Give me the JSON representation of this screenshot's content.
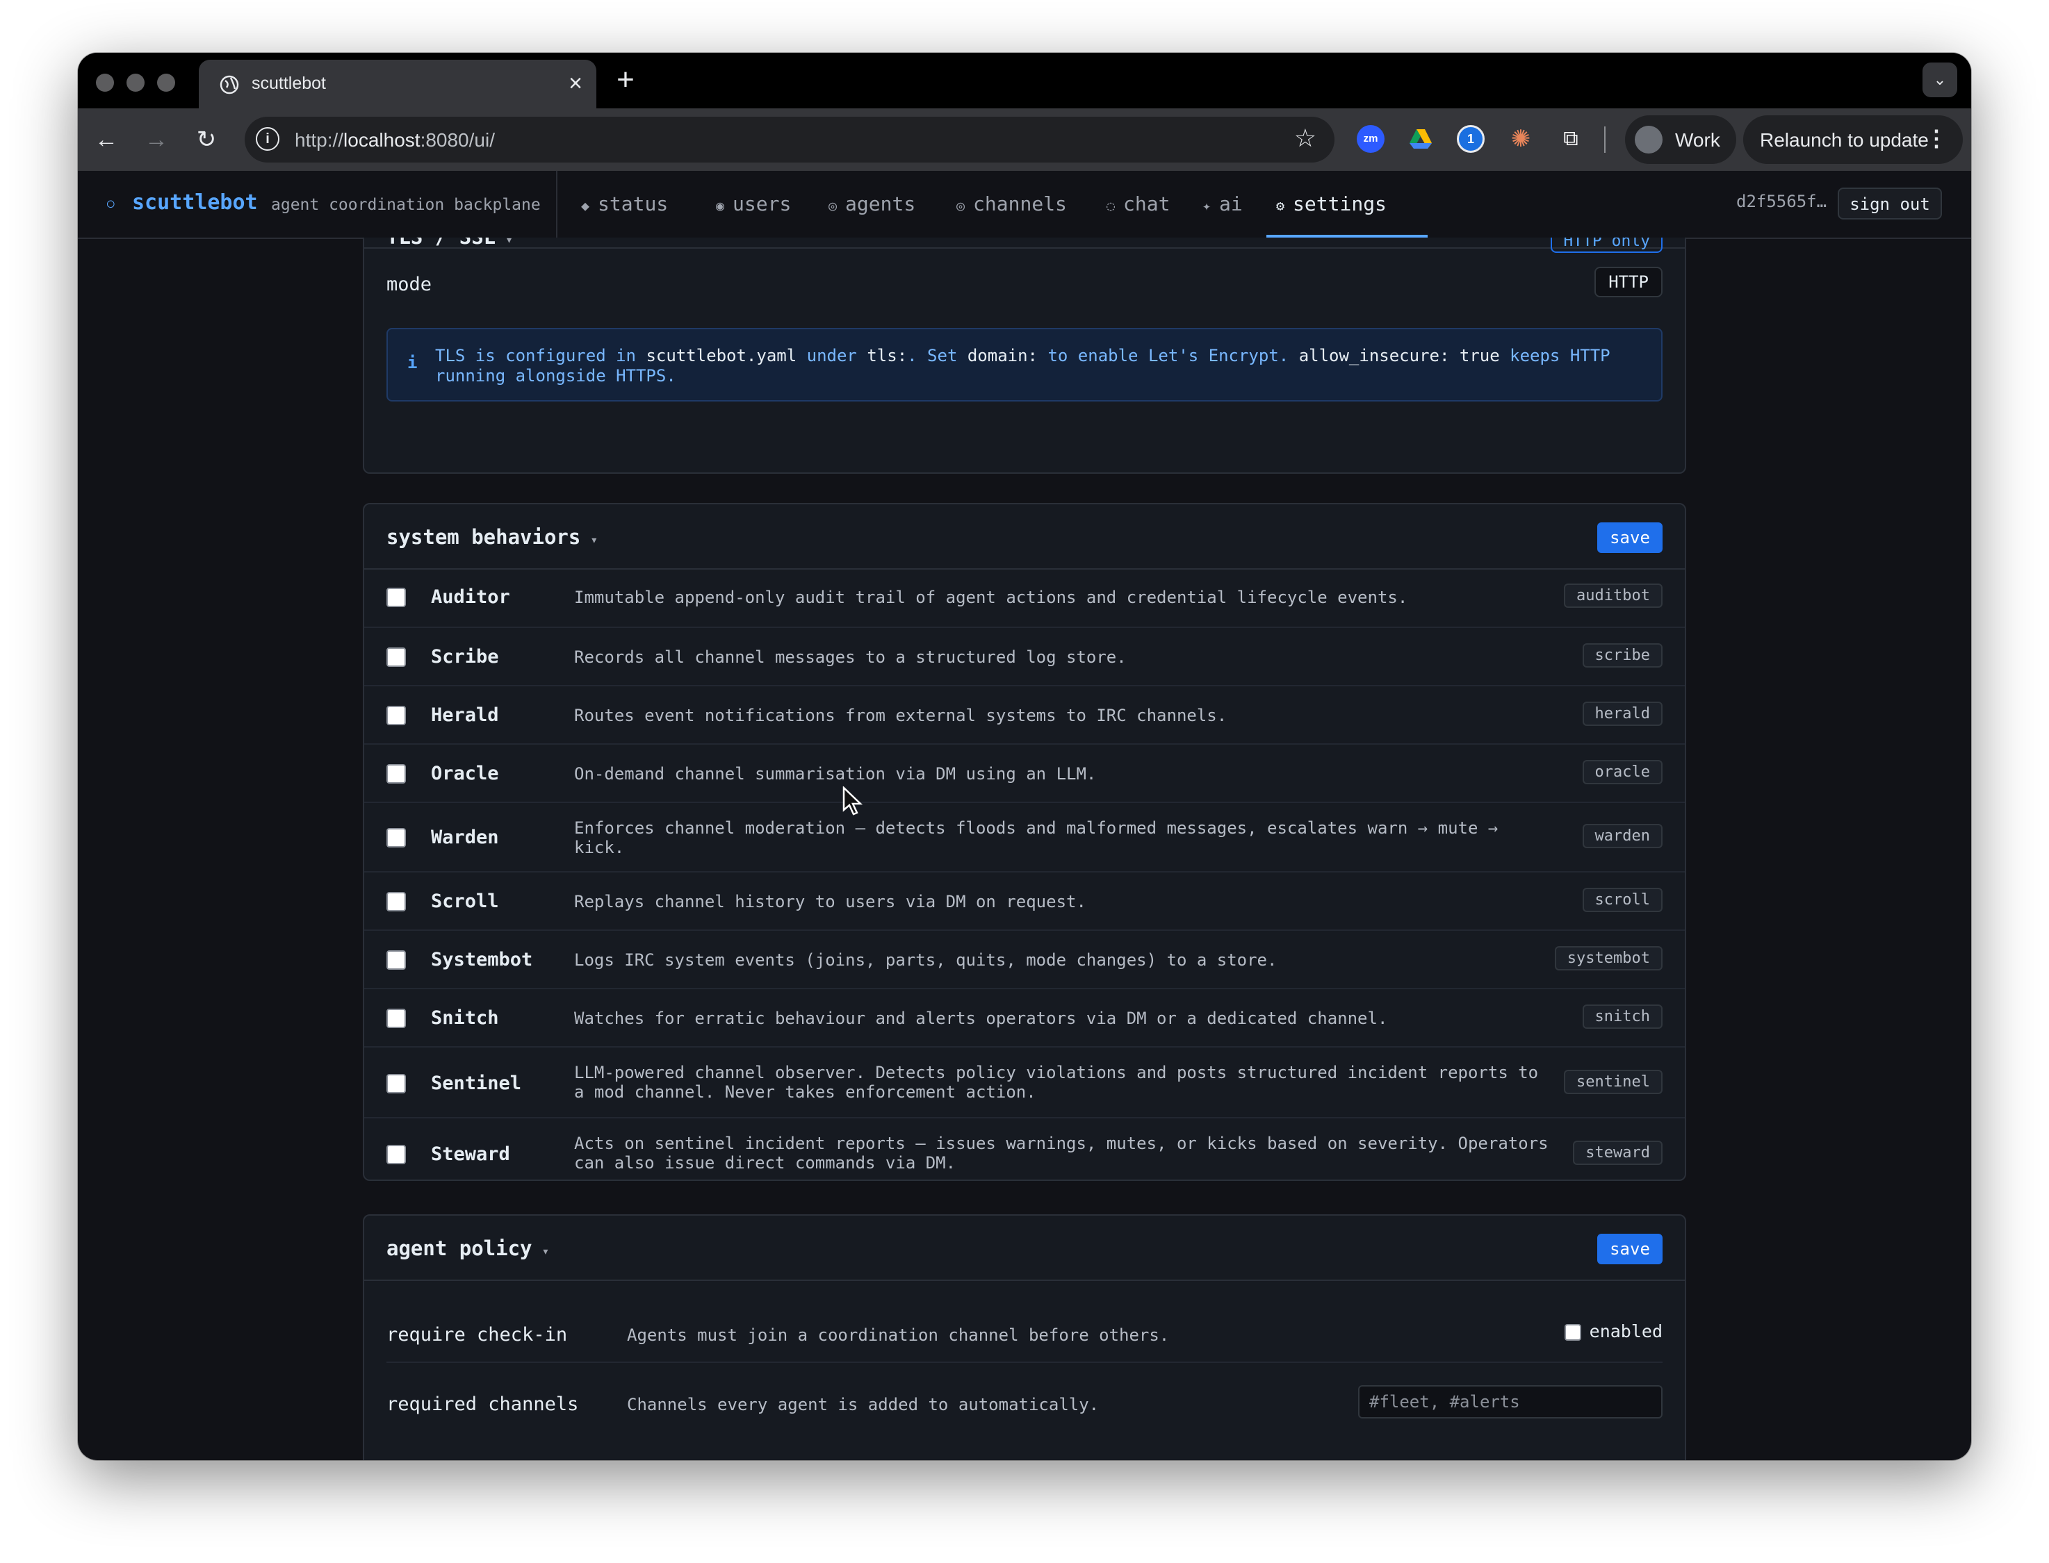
{
  "browser": {
    "tab_title": "scuttlebot",
    "url_prefix": "http://",
    "url_host": "localhost",
    "url_rest": ":8080/ui/",
    "profile_name": "Work",
    "relaunch_label": "Relaunch to update",
    "extensions": [
      "zoom-icon",
      "google-drive-icon",
      "password-manager-icon",
      "claude-icon",
      "puzzle-extensions-icon"
    ]
  },
  "app": {
    "brand": "scuttlebot",
    "tagline": "agent coordination backplane",
    "nav": [
      {
        "icon": "◆",
        "label": "status"
      },
      {
        "icon": "◉",
        "label": "users"
      },
      {
        "icon": "◎",
        "label": "agents"
      },
      {
        "icon": "◎",
        "label": "channels"
      },
      {
        "icon": "◌",
        "label": "chat"
      },
      {
        "icon": "✦",
        "label": "ai"
      },
      {
        "icon": "⚙",
        "label": "settings"
      }
    ],
    "active_nav": "settings",
    "session_id": "d2f5565f…",
    "sign_out": "sign out"
  },
  "tls": {
    "title": "TLS / SSL",
    "badge": "HTTP only",
    "mode_label": "mode",
    "mode_value": "HTTP",
    "notice": {
      "t1": "TLS is configured in ",
      "c1": "scuttlebot.yaml",
      "t2": " under ",
      "c2": "tls:",
      "t3": ". Set ",
      "c3": "domain:",
      "t4": " to enable Let's Encrypt. ",
      "c4": "allow_insecure: true",
      "t5": " keeps HTTP running alongside HTTPS."
    }
  },
  "system_behaviors": {
    "title": "system behaviors",
    "save_label": "save",
    "items": [
      {
        "name": "Auditor",
        "description": "Immutable append-only audit trail of agent actions and credential lifecycle events.",
        "tag": "auditbot",
        "checked": false
      },
      {
        "name": "Scribe",
        "description": "Records all channel messages to a structured log store.",
        "tag": "scribe",
        "checked": false
      },
      {
        "name": "Herald",
        "description": "Routes event notifications from external systems to IRC channels.",
        "tag": "herald",
        "checked": false
      },
      {
        "name": "Oracle",
        "description": "On-demand channel summarisation via DM using an LLM.",
        "tag": "oracle",
        "checked": false
      },
      {
        "name": "Warden",
        "description": "Enforces channel moderation — detects floods and malformed messages, escalates warn → mute → kick.",
        "tag": "warden",
        "checked": false
      },
      {
        "name": "Scroll",
        "description": "Replays channel history to users via DM on request.",
        "tag": "scroll",
        "checked": false
      },
      {
        "name": "Systembot",
        "description": "Logs IRC system events (joins, parts, quits, mode changes) to a store.",
        "tag": "systembot",
        "checked": false
      },
      {
        "name": "Snitch",
        "description": "Watches for erratic behaviour and alerts operators via DM or a dedicated channel.",
        "tag": "snitch",
        "checked": false
      },
      {
        "name": "Sentinel",
        "description": "LLM-powered channel observer. Detects policy violations and posts structured incident reports to a mod channel. Never takes enforcement action.",
        "tag": "sentinel",
        "checked": false
      },
      {
        "name": "Steward",
        "description": "Acts on sentinel incident reports — issues warnings, mutes, or kicks based on severity. Operators can also issue direct commands via DM.",
        "tag": "steward",
        "checked": false
      }
    ]
  },
  "agent_policy": {
    "title": "agent policy",
    "save_label": "save",
    "require_checkin": {
      "label": "require check-in",
      "description": "Agents must join a coordination channel before others.",
      "toggle_label": "enabled",
      "checked": false
    },
    "required_channels": {
      "label": "required channels",
      "description": "Channels every agent is added to automatically.",
      "placeholder": "#fleet, #alerts"
    }
  }
}
